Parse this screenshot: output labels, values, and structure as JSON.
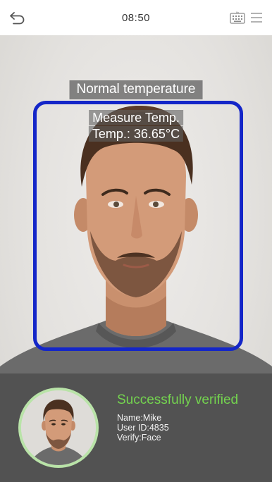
{
  "status_bar": {
    "time": "08:50",
    "back_icon": "back-arrow-icon",
    "keyboard_icon": "keyboard-icon",
    "menu_icon": "menu-icon"
  },
  "camera": {
    "temperature_status": "Normal temperature",
    "measure_label": "Measure Temp.",
    "temperature_reading": "Temp.: 36.65°C",
    "frame_color": "#1426c8"
  },
  "verification": {
    "status": "Successfully verified",
    "name": "Name:Mike",
    "user_id": "User ID:4835",
    "verify_mode": "Verify:Face",
    "status_color": "#74d44f"
  }
}
